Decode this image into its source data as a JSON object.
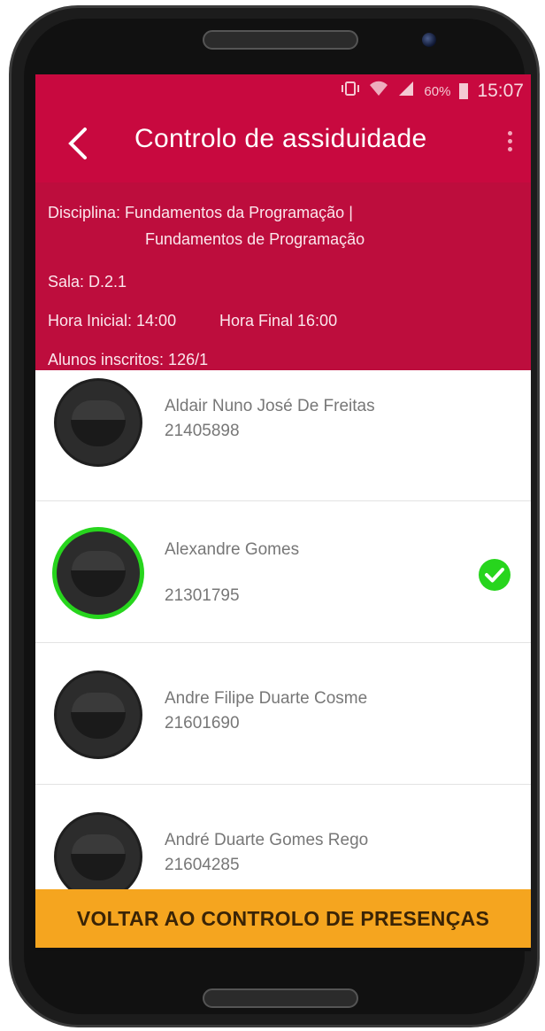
{
  "status_bar": {
    "battery": "60%",
    "time": "15:07"
  },
  "toolbar": {
    "title": "Controlo de assiduidade"
  },
  "info": {
    "disciplina_label": "Disciplina:",
    "disciplina_line1": "Fundamentos da Programação |",
    "disciplina_line2": "Fundamentos de Programação",
    "sala": "Sala: D.2.1",
    "hora_inicial": "Hora Inicial: 14:00",
    "hora_final": "Hora Final 16:00",
    "alunos": "Alunos inscritos: 126/1"
  },
  "students": [
    {
      "name": "Aldair Nuno José De Freitas",
      "number": "21405898",
      "present": false
    },
    {
      "name": "Alexandre Gomes",
      "number": "21301795",
      "present": true
    },
    {
      "name": "Andre Filipe Duarte Cosme",
      "number": "21601690",
      "present": false
    },
    {
      "name": "André Duarte Gomes Rego",
      "number": "21604285",
      "present": false
    }
  ],
  "bottom_button": {
    "label": "VOLTAR AO CONTROLO DE PRESENÇAS"
  },
  "colors": {
    "toolbar": "#c8093f",
    "info_panel": "#bd0d3d",
    "present_ring": "#27d51d",
    "bottom_button": "#f5a51f"
  }
}
